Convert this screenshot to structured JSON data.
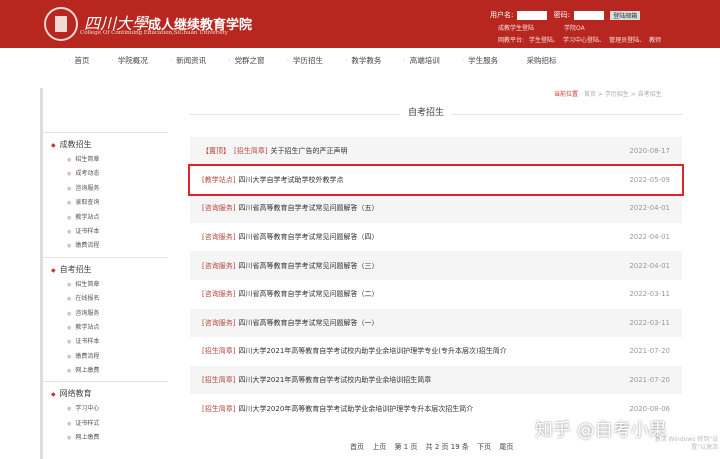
{
  "header": {
    "title_cal": "四川大學",
    "title": "成人继续教育学院",
    "subtitle": "College Of Continuing Education,SiChuan University",
    "username_label": "用户名:",
    "password_label": "密码:",
    "login_button": "登陆邮箱",
    "links1": [
      "成教学生登陆",
      "学院OA"
    ],
    "links2_label": "网教平台:",
    "links2": [
      "学生登陆、",
      "学习中心登陆、",
      "管理员登陆、",
      "教师"
    ]
  },
  "nav": [
    "首页",
    "学院概况",
    "新闻资讯",
    "党群之窗",
    "学历招生",
    "教学教务",
    "高端培训",
    "学生服务",
    "采购招标"
  ],
  "sidebar": [
    {
      "title": "成教招生",
      "items": [
        "招生简章",
        "成考动态",
        "咨询服务",
        "录取查询",
        "教学站点",
        "证书样本",
        "缴费流程"
      ]
    },
    {
      "title": "自考招生",
      "items": [
        "招生简章",
        "在线报名",
        "咨询服务",
        "教学站点",
        "证书样本",
        "缴费流程",
        "网上缴费"
      ]
    },
    {
      "title": "网络教育",
      "items": [
        "学习中心",
        "证书样式",
        "网上缴费"
      ]
    }
  ],
  "breadcrumb": {
    "label": "当前位置",
    "path": "首页 > 学历招生 > 自考招生"
  },
  "section_title": "自考招生",
  "articles": [
    {
      "pin": "【置顶】",
      "tag": "[招生简章]",
      "title": "关于招生广告的严正声明",
      "date": "2020-08-17"
    },
    {
      "tag": "[教学站点]",
      "title": "四川大学自学考试助学校外教学点",
      "date": "2022-05-09",
      "highlighted": true
    },
    {
      "tag": "[咨询服务]",
      "title": "四川省高等教育自学考试常见问题解答（五）",
      "date": "2022-04-01"
    },
    {
      "tag": "[咨询服务]",
      "title": "四川省高等教育自学考试常见问题解答（四）",
      "date": "2022-04-01"
    },
    {
      "tag": "[咨询服务]",
      "title": "四川省高等教育自学考试常见问题解答（三）",
      "date": "2022-04-01"
    },
    {
      "tag": "[咨询服务]",
      "title": "四川省高等教育自学考试常见问题解答（二）",
      "date": "2022-03-11"
    },
    {
      "tag": "[咨询服务]",
      "title": "四川省高等教育自学考试常见问题解答（一）",
      "date": "2022-03-11"
    },
    {
      "tag": "[招生简章]",
      "title": "四川大学2021年高等教育自学考试校内助学业余培训护理学专业(专升本层次)招生简介",
      "date": "2021-07-20"
    },
    {
      "tag": "[招生简章]",
      "title": "四川大学2021年高等教育自学考试校内助学业余培训招生简章",
      "date": "2021-07-20"
    },
    {
      "tag": "[招生简章]",
      "title": "四川大学2020年高等教育自学考试助学业余培训护理学专升本层次招生简介",
      "date": "2020-08-06"
    }
  ],
  "pager": [
    "首页",
    "上页",
    "第 1 页",
    "共 2 页 19 条",
    "下页",
    "尾页"
  ],
  "watermark": "知乎 @自考小果",
  "activation": "激活 Windows 转到\"设置\"以激活"
}
